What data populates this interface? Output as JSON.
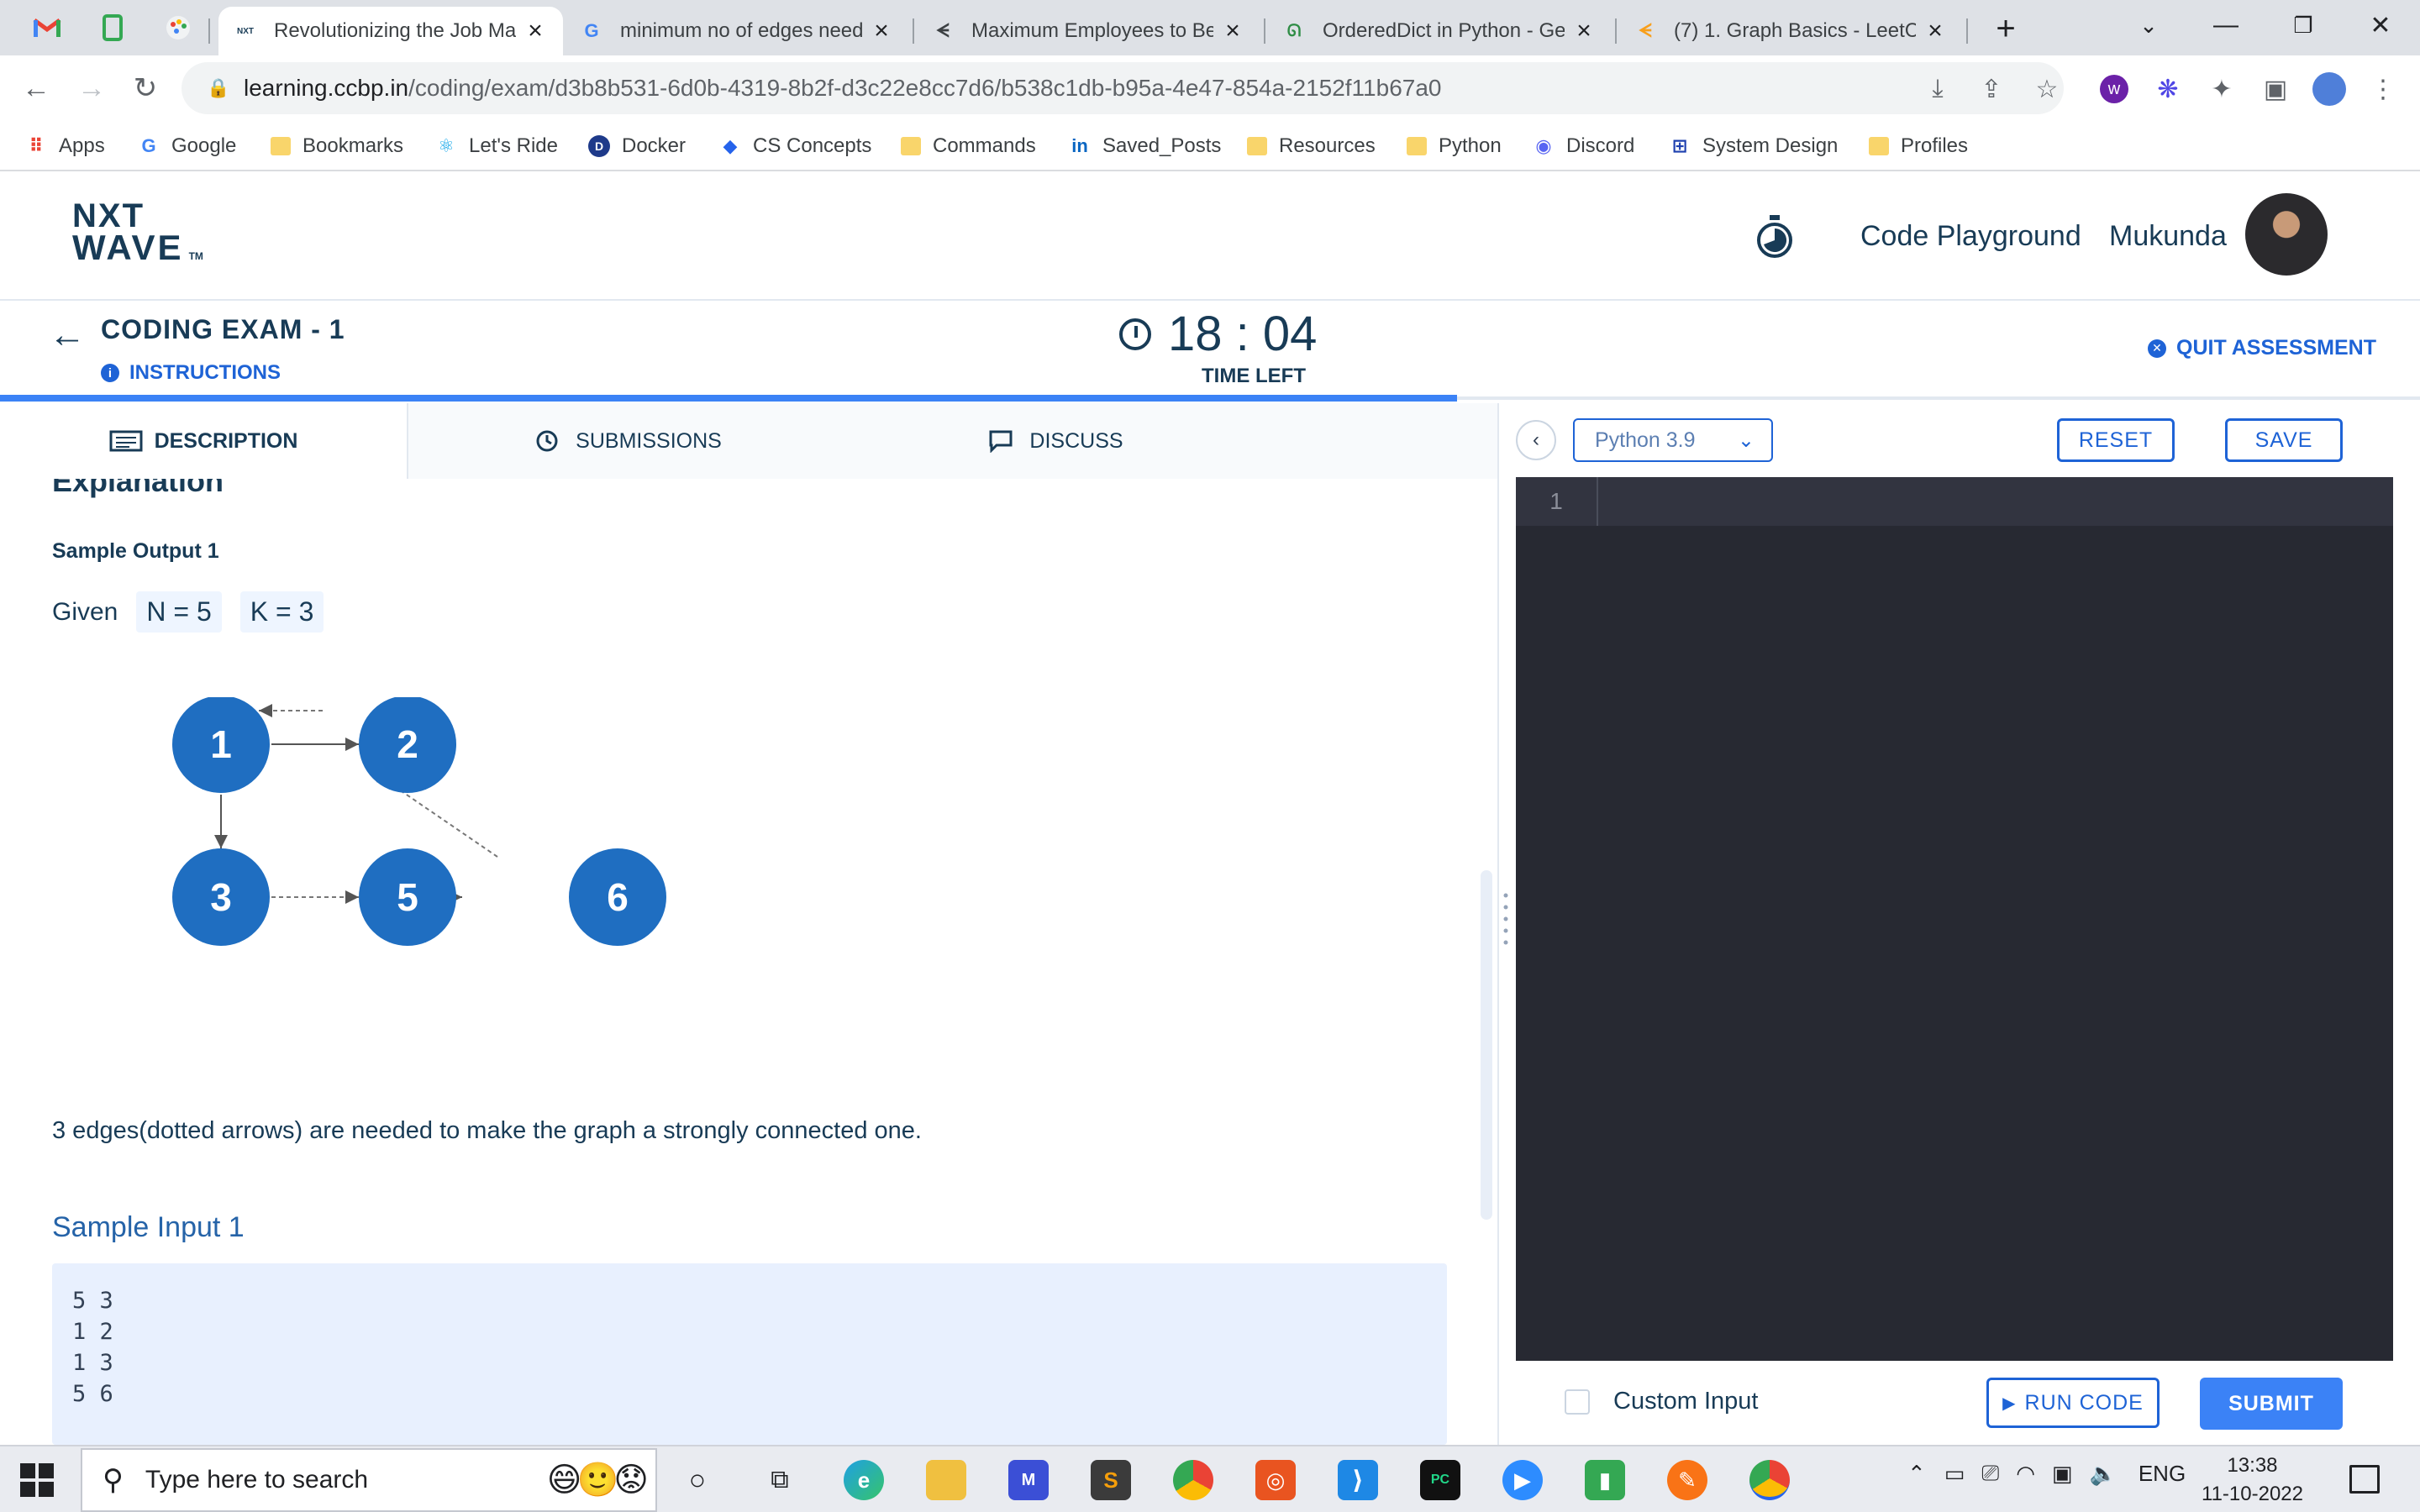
{
  "browser": {
    "tabs": [
      {
        "title": "Revolutionizing the Job Ma",
        "active": true
      },
      {
        "title": "minimum no of edges need",
        "active": false
      },
      {
        "title": "Maximum Employees to Be",
        "active": false
      },
      {
        "title": "OrderedDict in Python - Ge",
        "active": false
      },
      {
        "title": "(7) 1. Graph Basics - LeetCo",
        "active": false
      }
    ],
    "url_host": "learning.ccbp.in",
    "url_path": "/coding/exam/d3b8b531-6d0b-4319-8b2f-d3c22e8cc7d6/b538c1db-b95a-4e47-854a-2152f11b67a0",
    "bookmarks": [
      "Apps",
      "Google",
      "Bookmarks",
      "Let's Ride",
      "Docker",
      "CS Concepts",
      "Commands",
      "Saved_Posts",
      "Resources",
      "Python",
      "Discord",
      "System Design",
      "Profiles"
    ]
  },
  "header": {
    "logo_line1": "NXT",
    "logo_line2": "WAVE",
    "logo_tm": "TM",
    "code_playground": "Code Playground",
    "username": "Mukunda"
  },
  "exam": {
    "title": "CODING EXAM - 1",
    "instructions": "INSTRUCTIONS",
    "timer": "18 : 04",
    "time_left_label": "TIME LEFT",
    "quit_label": "QUIT ASSESSMENT",
    "progress_fraction": 0.602
  },
  "left_tabs": {
    "description": "DESCRIPTION",
    "submissions": "SUBMISSIONS",
    "discuss": "DISCUSS"
  },
  "description": {
    "explanation_heading": "Explanation",
    "sample_output_label": "Sample Output 1",
    "given_label": "Given",
    "n_chip": "N = 5",
    "k_chip": "K = 3",
    "graph_nodes": [
      "1",
      "2",
      "3",
      "5",
      "6"
    ],
    "explanation_text": "3 edges(dotted arrows) are needed to make the graph a strongly connected one.",
    "sample_input_label": "Sample Input 1",
    "sample_input_lines": [
      "5 3",
      "1 2",
      "1 3",
      "5 6"
    ]
  },
  "editor": {
    "language": "Python 3.9",
    "reset_label": "RESET",
    "save_label": "SAVE",
    "line_number": "1",
    "custom_input_label": "Custom Input",
    "run_code_label": "RUN CODE",
    "submit_label": "SUBMIT"
  },
  "taskbar": {
    "search_placeholder": "Type here to search",
    "language": "ENG",
    "time": "13:38",
    "date": "11-10-2022"
  },
  "colors": {
    "brand_blue": "#1e63d6",
    "node_blue": "#1f6ec1",
    "navy": "#183b56",
    "editor_bg": "#272932"
  }
}
